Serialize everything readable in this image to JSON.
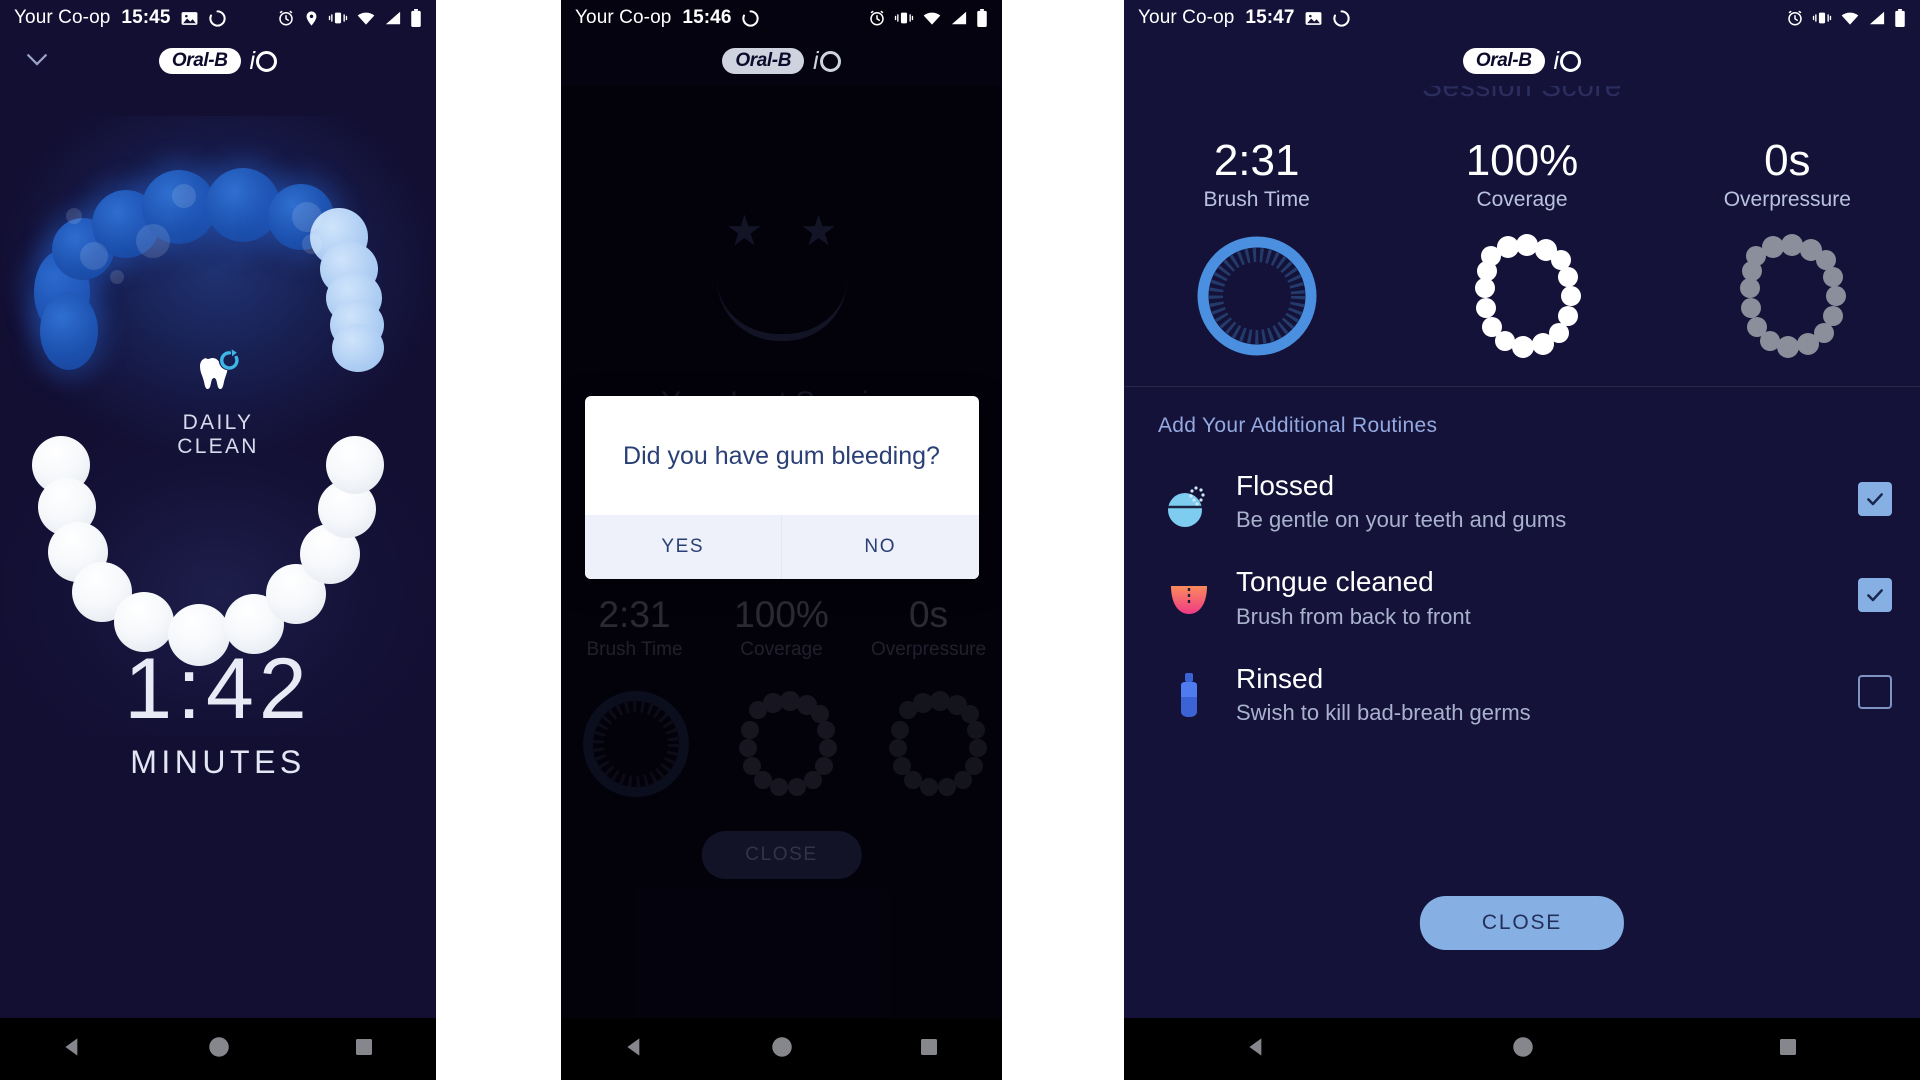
{
  "statusbar": {
    "carrier": "Your Co-op",
    "time_p1": "15:45",
    "time_p2": "15:46",
    "time_p3": "15:47",
    "icons": [
      "image-icon",
      "sync-icon",
      "alarm-icon",
      "location-icon",
      "vibrate-icon",
      "wifi-icon",
      "signal-icon",
      "battery-icon"
    ]
  },
  "brand": {
    "logo": "Oral-B",
    "sub": "iO",
    "collapse_icon": "chevron-down-icon"
  },
  "panel1": {
    "mode_icon": "tooth-refresh-icon",
    "mode_line1": "DAILY",
    "mode_line2": "CLEAN",
    "timer_value": "1:42",
    "timer_unit": "MINUTES",
    "teeth_map": {
      "upper_state": "cleaned",
      "lower_state": "not-cleaned",
      "clean_color": "#1d52b0",
      "pale_color": "#aecdf3",
      "uncleaned_color": "#ffffff"
    }
  },
  "panel2": {
    "face_stars": [
      "★",
      "★"
    ],
    "session_text": "Your Last Session",
    "dialog": {
      "question": "Did you have gum bleeding?",
      "yes": "YES",
      "no": "NO"
    },
    "metrics": [
      {
        "value": "2:31",
        "label": "Brush Time"
      },
      {
        "value": "100%",
        "label": "Coverage"
      },
      {
        "value": "0s",
        "label": "Overpressure"
      }
    ],
    "close_label": "CLOSE"
  },
  "panel3": {
    "ghost_title": "Session Score",
    "metrics": [
      {
        "value": "2:31",
        "label": "Brush Time"
      },
      {
        "value": "100%",
        "label": "Coverage"
      },
      {
        "value": "0s",
        "label": "Overpressure"
      }
    ],
    "section_title": "Add Your Additional Routines",
    "routines": [
      {
        "title": "Flossed",
        "subtitle": "Be gentle on your teeth and gums",
        "icon": "floss-container-icon",
        "checked": true
      },
      {
        "title": "Tongue cleaned",
        "subtitle": "Brush from back to front",
        "icon": "tongue-icon",
        "checked": true
      },
      {
        "title": "Rinsed",
        "subtitle": "Swish to kill bad-breath germs",
        "icon": "mouthwash-bottle-icon",
        "checked": false
      }
    ],
    "close_label": "CLOSE"
  },
  "navbar": {
    "back": "back-triangle-icon",
    "home": "home-circle-icon",
    "recents": "recents-square-icon"
  },
  "colors": {
    "bg_panel1": "#130f33",
    "bg_panel2": "#05030f",
    "bg_panel3": "#141238",
    "accent_blue": "#86b0e3",
    "clean_blue": "#1d52b0",
    "dialog_text": "#2a3f75"
  }
}
